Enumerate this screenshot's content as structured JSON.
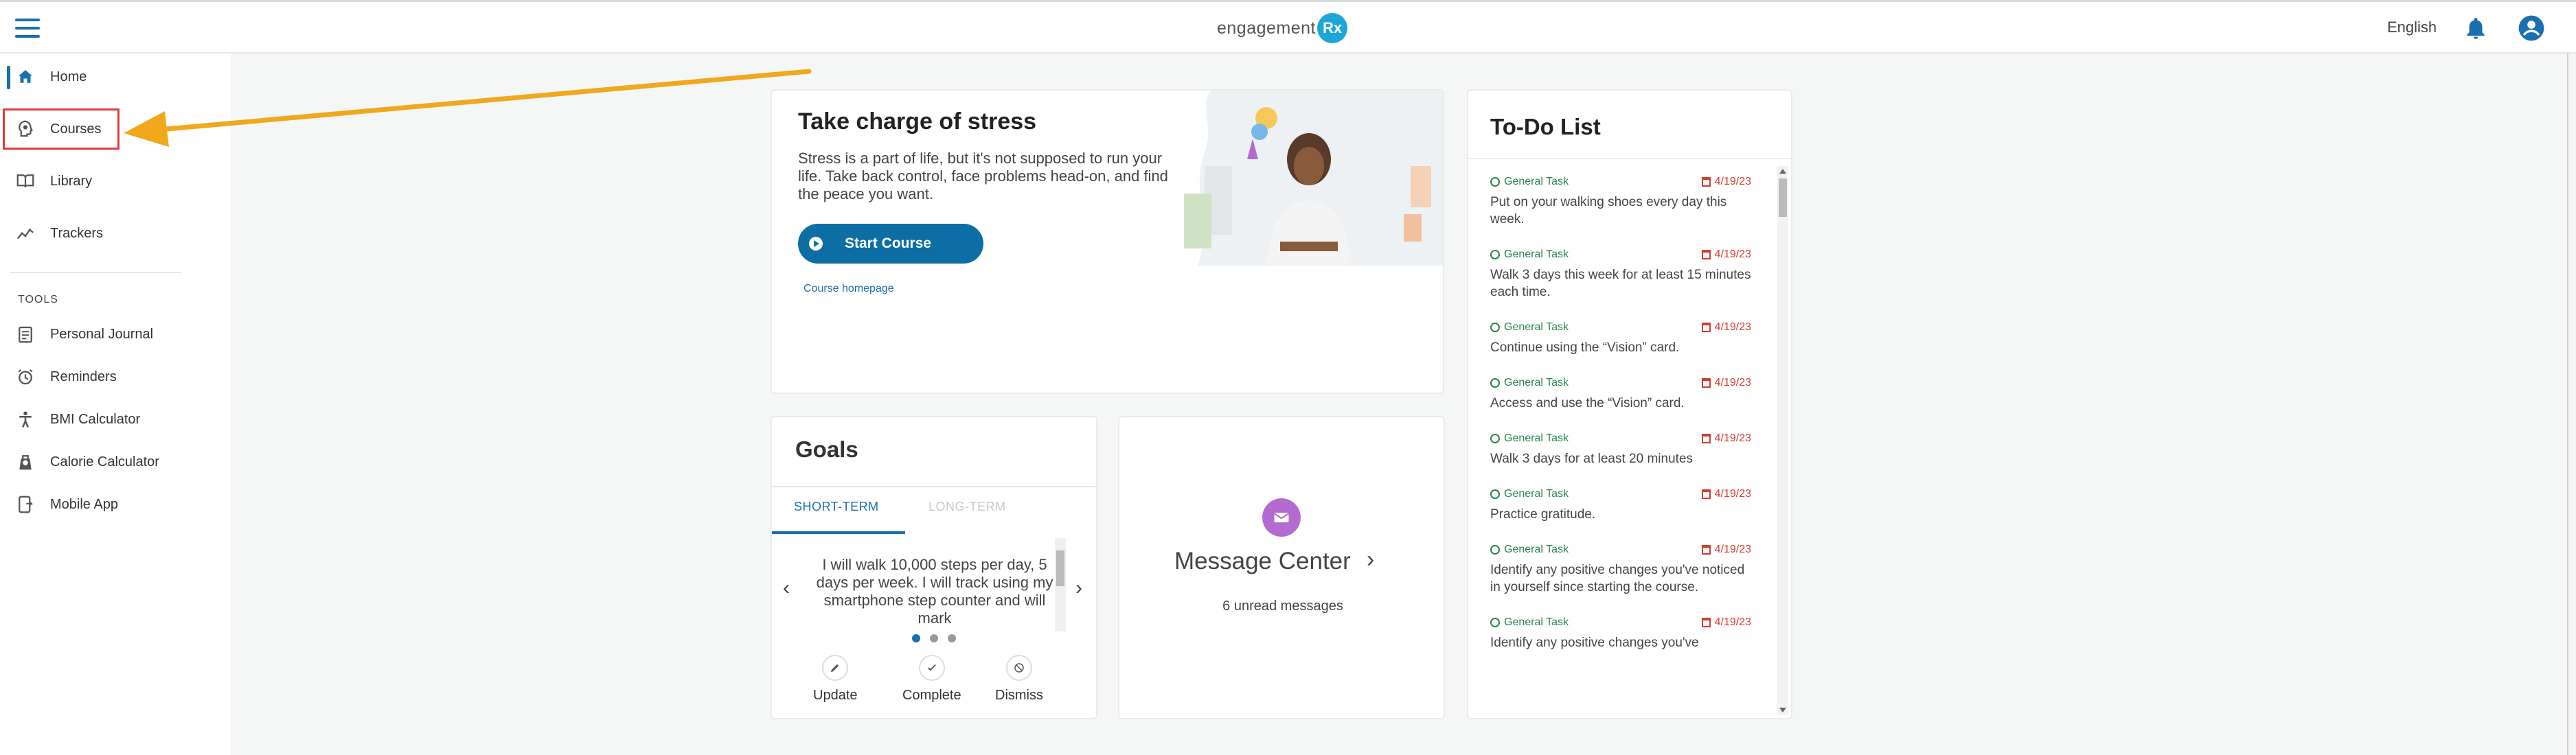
{
  "header": {
    "logo_text": "engagement",
    "logo_badge": "Rx",
    "language": "English"
  },
  "sidebar": {
    "items": [
      {
        "label": "Home",
        "icon": "home-icon"
      },
      {
        "label": "Courses",
        "icon": "lightbulb-head-icon"
      },
      {
        "label": "Library",
        "icon": "book-icon"
      },
      {
        "label": "Trackers",
        "icon": "chart-line-icon"
      }
    ],
    "tools_label": "TOOLS",
    "tools": [
      {
        "label": "Personal Journal",
        "icon": "journal-icon"
      },
      {
        "label": "Reminders",
        "icon": "alarm-clock-icon"
      },
      {
        "label": "BMI Calculator",
        "icon": "person-icon"
      },
      {
        "label": "Calorie Calculator",
        "icon": "scale-icon"
      },
      {
        "label": "Mobile App",
        "icon": "mobile-icon"
      }
    ]
  },
  "course": {
    "title": "Take charge of stress",
    "description": "Stress is a part of life, but it's not supposed to run your life. Take back control, face problems head-on, and find the peace you want.",
    "start_label": "Start Course",
    "link_label": "Course homepage"
  },
  "goals": {
    "title": "Goals",
    "tab_short": "SHORT-TERM",
    "tab_long": "LONG-TERM",
    "text": "I will walk 10,000 steps per day, 5 days per week. I will track using my smartphone step counter and will mark",
    "actions": {
      "update": "Update",
      "complete": "Complete",
      "dismiss": "Dismiss"
    }
  },
  "messages": {
    "title": "Message Center",
    "count_text": "6 unread messages"
  },
  "todo": {
    "title": "To-Do List",
    "items": [
      {
        "tag": "General Task",
        "date": "4/19/23",
        "text": "Put on your walking shoes every day this week."
      },
      {
        "tag": "General Task",
        "date": "4/19/23",
        "text": "Walk 3 days this week for at least 15 minutes each time."
      },
      {
        "tag": "General Task",
        "date": "4/19/23",
        "text": "Continue using the “Vision” card."
      },
      {
        "tag": "General Task",
        "date": "4/19/23",
        "text": "Access and use the “Vision” card."
      },
      {
        "tag": "General Task",
        "date": "4/19/23",
        "text": "Walk 3 days for at least 20 minutes"
      },
      {
        "tag": "General Task",
        "date": "4/19/23",
        "text": "Practice gratitude."
      },
      {
        "tag": "General Task",
        "date": "4/19/23",
        "text": "Identify any positive changes you've noticed in yourself since starting the course."
      },
      {
        "tag": "General Task",
        "date": "4/19/23",
        "text": "Identify any positive changes you've"
      }
    ]
  },
  "colors": {
    "brand_blue": "#1a6fb0",
    "button_blue": "#0c6ea4",
    "task_green": "#27854a",
    "date_red": "#d63b2f",
    "highlight_red": "#e03a3a",
    "arrow_orange": "#f0a81c",
    "message_purple": "#b46bd1"
  }
}
